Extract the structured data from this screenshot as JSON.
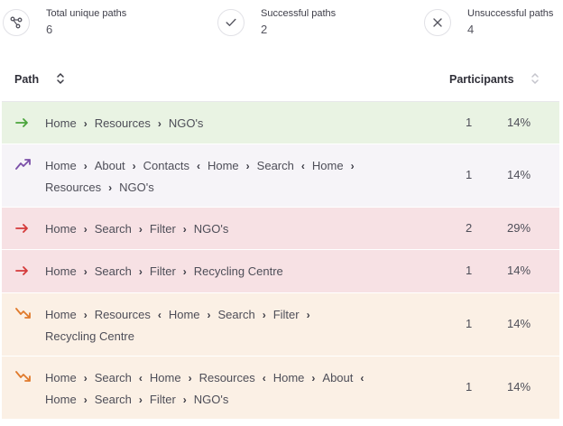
{
  "summary": {
    "total": {
      "label": "Total unique paths",
      "value": "6",
      "icon": "branch-icon"
    },
    "successful": {
      "label": "Successful paths",
      "value": "2",
      "icon": "check-icon"
    },
    "unsuccessful": {
      "label": "Unsuccessful paths",
      "value": "4",
      "icon": "close-icon"
    }
  },
  "table": {
    "path_header": "Path",
    "participants_header": "Participants"
  },
  "colors": {
    "direct_success": "#4aa53c",
    "indirect_success": "#7b4fa8",
    "direct_fail": "#d43a3a",
    "indirect_fail": "#e07a2c"
  },
  "rows": [
    {
      "outcome": "direct-success",
      "lines": [
        [
          {
            "t": "crumb",
            "v": "Home"
          },
          {
            "t": "sep",
            "v": "›"
          },
          {
            "t": "crumb",
            "v": "Resources"
          },
          {
            "t": "sep",
            "v": "›"
          },
          {
            "t": "crumb",
            "v": "NGO's"
          }
        ]
      ],
      "count": "1",
      "percent": "14%"
    },
    {
      "outcome": "indirect-success",
      "lines": [
        [
          {
            "t": "crumb",
            "v": "Home"
          },
          {
            "t": "sep",
            "v": "›"
          },
          {
            "t": "crumb",
            "v": "About"
          },
          {
            "t": "sep",
            "v": "›"
          },
          {
            "t": "crumb",
            "v": "Contacts"
          },
          {
            "t": "sep",
            "v": "‹"
          },
          {
            "t": "crumb",
            "v": "Home"
          },
          {
            "t": "sep",
            "v": "›"
          },
          {
            "t": "crumb",
            "v": "Search"
          },
          {
            "t": "sep",
            "v": "‹"
          },
          {
            "t": "crumb",
            "v": "Home"
          },
          {
            "t": "sep",
            "v": "›"
          }
        ],
        [
          {
            "t": "crumb",
            "v": "Resources"
          },
          {
            "t": "sep",
            "v": "›"
          },
          {
            "t": "crumb",
            "v": "NGO's"
          }
        ]
      ],
      "count": "1",
      "percent": "14%"
    },
    {
      "outcome": "direct-fail",
      "lines": [
        [
          {
            "t": "crumb",
            "v": "Home"
          },
          {
            "t": "sep",
            "v": "›"
          },
          {
            "t": "crumb",
            "v": "Search"
          },
          {
            "t": "sep",
            "v": "›"
          },
          {
            "t": "crumb",
            "v": "Filter"
          },
          {
            "t": "sep",
            "v": "›"
          },
          {
            "t": "crumb",
            "v": "NGO's"
          }
        ]
      ],
      "count": "2",
      "percent": "29%"
    },
    {
      "outcome": "direct-fail",
      "lines": [
        [
          {
            "t": "crumb",
            "v": "Home"
          },
          {
            "t": "sep",
            "v": "›"
          },
          {
            "t": "crumb",
            "v": "Search"
          },
          {
            "t": "sep",
            "v": "›"
          },
          {
            "t": "crumb",
            "v": "Filter"
          },
          {
            "t": "sep",
            "v": "›"
          },
          {
            "t": "crumb",
            "v": "Recycling Centre"
          }
        ]
      ],
      "count": "1",
      "percent": "14%"
    },
    {
      "outcome": "indirect-fail",
      "lines": [
        [
          {
            "t": "crumb",
            "v": "Home"
          },
          {
            "t": "sep",
            "v": "›"
          },
          {
            "t": "crumb",
            "v": "Resources"
          },
          {
            "t": "sep",
            "v": "‹"
          },
          {
            "t": "crumb",
            "v": "Home"
          },
          {
            "t": "sep",
            "v": "›"
          },
          {
            "t": "crumb",
            "v": "Search"
          },
          {
            "t": "sep",
            "v": "›"
          },
          {
            "t": "crumb",
            "v": "Filter"
          },
          {
            "t": "sep",
            "v": "›"
          }
        ],
        [
          {
            "t": "crumb",
            "v": "Recycling Centre"
          }
        ]
      ],
      "count": "1",
      "percent": "14%"
    },
    {
      "outcome": "indirect-fail",
      "lines": [
        [
          {
            "t": "crumb",
            "v": "Home"
          },
          {
            "t": "sep",
            "v": "›"
          },
          {
            "t": "crumb",
            "v": "Search"
          },
          {
            "t": "sep",
            "v": "‹"
          },
          {
            "t": "crumb",
            "v": "Home"
          },
          {
            "t": "sep",
            "v": "›"
          },
          {
            "t": "crumb",
            "v": "Resources"
          },
          {
            "t": "sep",
            "v": "‹"
          },
          {
            "t": "crumb",
            "v": "Home"
          },
          {
            "t": "sep",
            "v": "›"
          },
          {
            "t": "crumb",
            "v": "About"
          },
          {
            "t": "sep",
            "v": "‹"
          }
        ],
        [
          {
            "t": "crumb",
            "v": "Home"
          },
          {
            "t": "sep",
            "v": "›"
          },
          {
            "t": "crumb",
            "v": "Search"
          },
          {
            "t": "sep",
            "v": "›"
          },
          {
            "t": "crumb",
            "v": "Filter"
          },
          {
            "t": "sep",
            "v": "›"
          },
          {
            "t": "crumb",
            "v": "NGO's"
          }
        ]
      ],
      "count": "1",
      "percent": "14%"
    }
  ]
}
